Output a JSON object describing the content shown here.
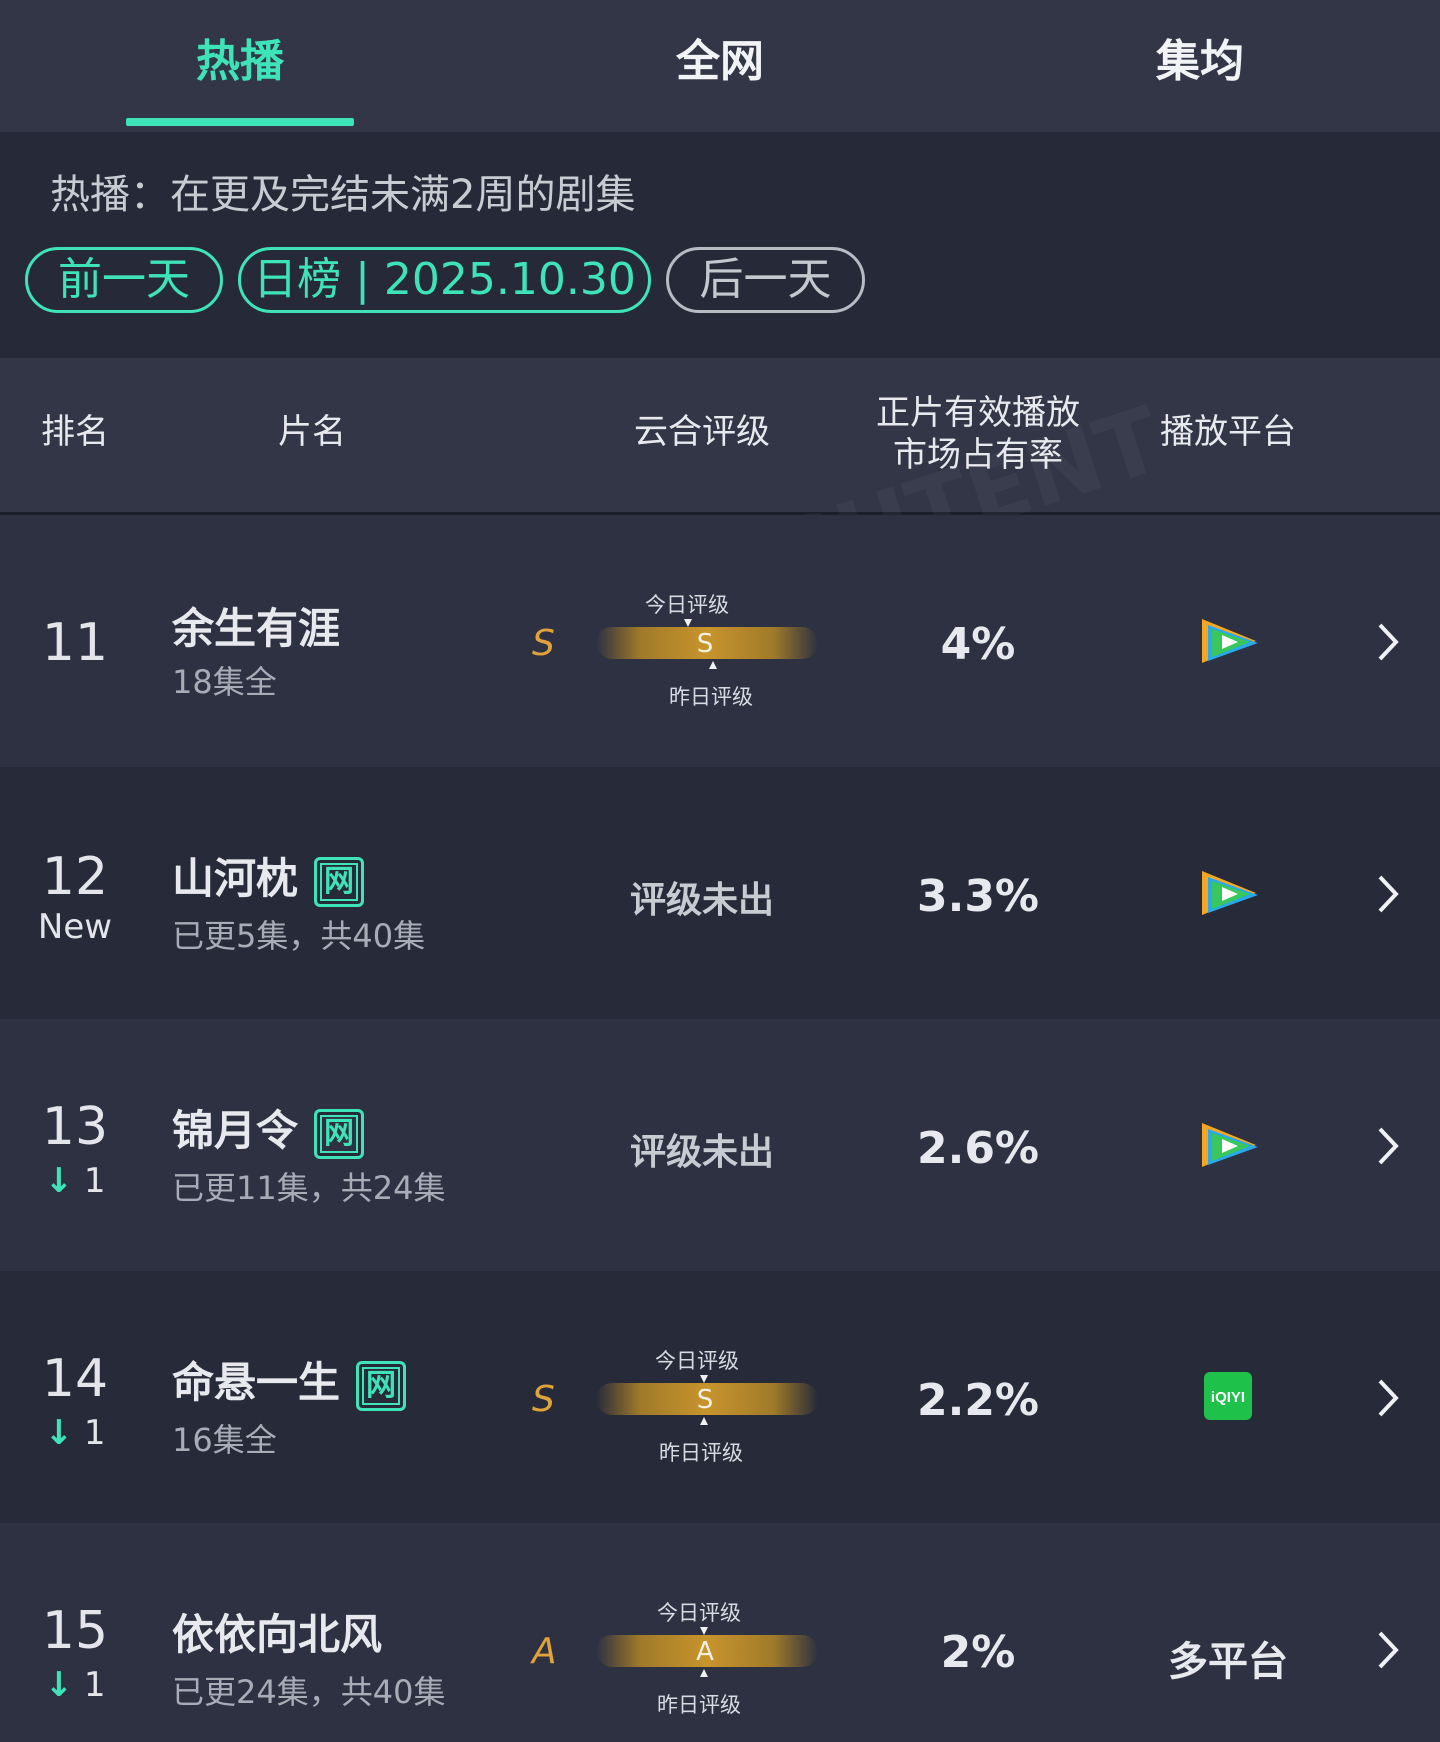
{
  "tabs": [
    {
      "label": "热播",
      "active": true
    },
    {
      "label": "全网",
      "active": false
    },
    {
      "label": "集均",
      "active": false
    }
  ],
  "description": "热播：在更及完结未满2周的剧集",
  "nav": {
    "prev": "前一天",
    "date": "日榜 | 2025.10.30",
    "next": "后一天"
  },
  "columns": {
    "rank": "排名",
    "title": "片名",
    "rating": "云合评级",
    "share": "正片有效播放\n市场占有率",
    "platform": "播放平台"
  },
  "rating_labels": {
    "today": "今日评级",
    "yesterday": "昨日评级"
  },
  "rows": [
    {
      "rank": "11",
      "change": "",
      "title": "余生有涯",
      "badge": "",
      "sub": "18集全",
      "grade": "S",
      "grade_mark": "S",
      "not_rated": "",
      "share": "4%",
      "platform": "tencent-video-icon"
    },
    {
      "rank": "12",
      "change": "New",
      "title": "山河枕",
      "badge": "网",
      "sub": "已更5集，共40集",
      "grade": "",
      "grade_mark": "",
      "not_rated": "评级未出",
      "share": "3.3%",
      "platform": "tencent-video-icon"
    },
    {
      "rank": "13",
      "change": "1",
      "title": "锦月令",
      "badge": "网",
      "sub": "已更11集，共24集",
      "grade": "",
      "grade_mark": "",
      "not_rated": "评级未出",
      "share": "2.6%",
      "platform": "tencent-video-icon"
    },
    {
      "rank": "14",
      "change": "1",
      "title": "命悬一生",
      "badge": "网",
      "sub": "16集全",
      "grade": "S",
      "grade_mark": "S",
      "not_rated": "",
      "share": "2.2%",
      "platform": "iqiyi-icon"
    },
    {
      "rank": "15",
      "change": "1",
      "title": "依依向北风",
      "badge": "",
      "sub": "已更24集，共40集",
      "grade": "A",
      "grade_mark": "A",
      "not_rated": "",
      "share": "2%",
      "platform": "多平台"
    }
  ],
  "iqiyi_text": "iQIYI",
  "colors": {
    "accent": "#3fe3b8",
    "gold": "#e0a23a",
    "bg": "#262a38"
  }
}
